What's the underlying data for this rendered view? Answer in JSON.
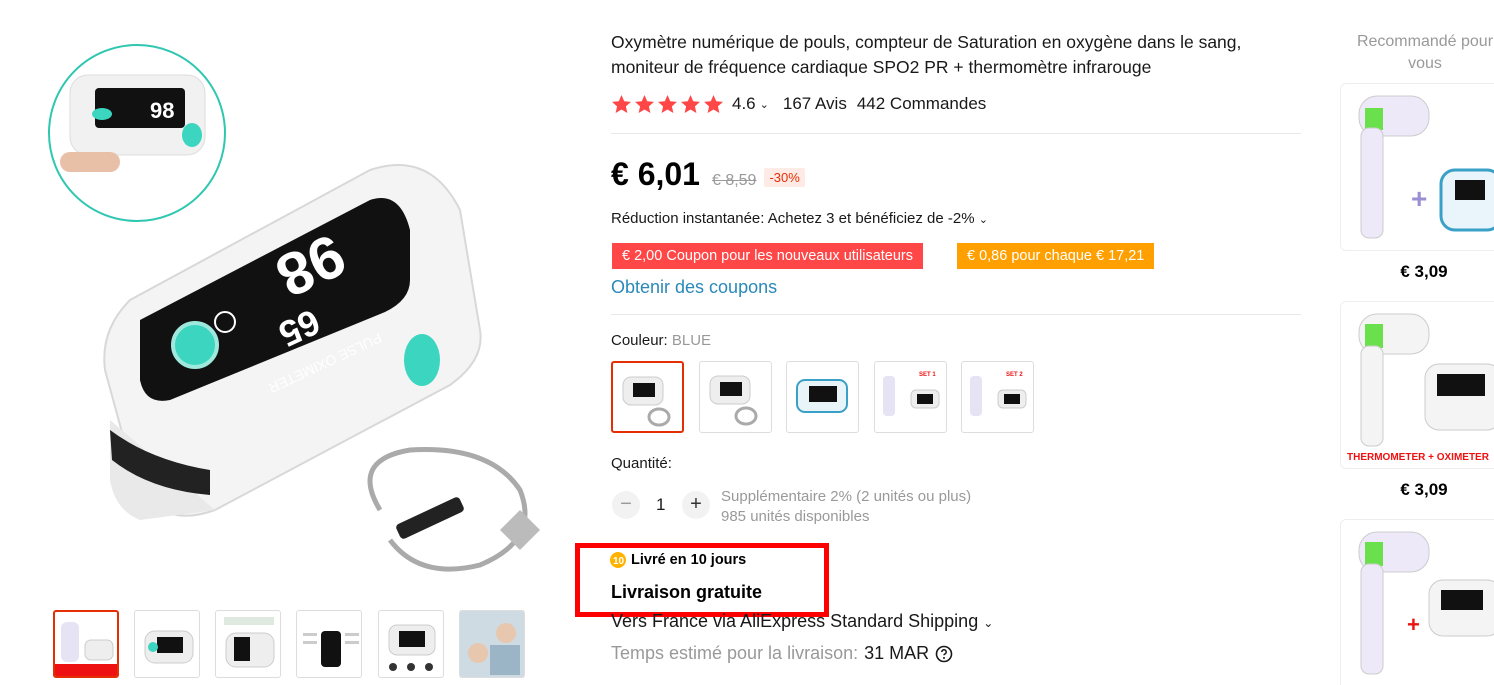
{
  "product": {
    "title": "Oxymètre numérique de pouls, compteur de Saturation en oxygène dans le sang, moniteur de fréquence cardiaque SPO2 PR + thermomètre infrarouge",
    "rating": "4.6",
    "reviews": "167 Avis",
    "orders": "442 Commandes",
    "price": "€ 6,01",
    "old_price": "€ 8,59",
    "discount": "-30%",
    "instant_discount": "Réduction instantanée: Achetez 3 et bénéficiez de -2%",
    "coupon_new_users": "€ 2,00 Coupon pour les nouveaux utilisateurs",
    "coupon_every": "€ 0,86 pour chaque € 17,21",
    "get_coupons": "Obtenir des coupons",
    "color_label": "Couleur:",
    "color_selected": "BLUE",
    "quantity_label": "Quantité:",
    "quantity": "1",
    "qty_minus": "−",
    "qty_plus": "+",
    "extra_discount": "Supplémentaire 2% (2 unités ou plus)",
    "stock": "985 unités disponibles",
    "delivered_in": "Livré en 10 jours",
    "free_delivery": "Livraison gratuite",
    "shipping_to": "Vers France via AliExpress Standard Shipping",
    "est_label": "Temps estimé pour la livraison:",
    "est_date": "31 MAR",
    "thumb_texts": {
      "banner": "PULSE OXIMETER",
      "spo2": "98",
      "pr": "65",
      "set1": "SET 1",
      "set2": "SET 2"
    }
  },
  "recommended": {
    "title": "Recommandé pour vous",
    "items": [
      {
        "price": "€ 3,09"
      },
      {
        "price": "€ 3,09",
        "banner": "THERMOMETER + OXIMETER"
      },
      {
        "price": ""
      }
    ]
  },
  "colors": {
    "accent": "#e62e04",
    "star": "#ff4747",
    "coupon_red": "#ff4747",
    "coupon_orange": "#ffa000",
    "link": "#2b89b9",
    "highlight_box": "#ff0000"
  }
}
